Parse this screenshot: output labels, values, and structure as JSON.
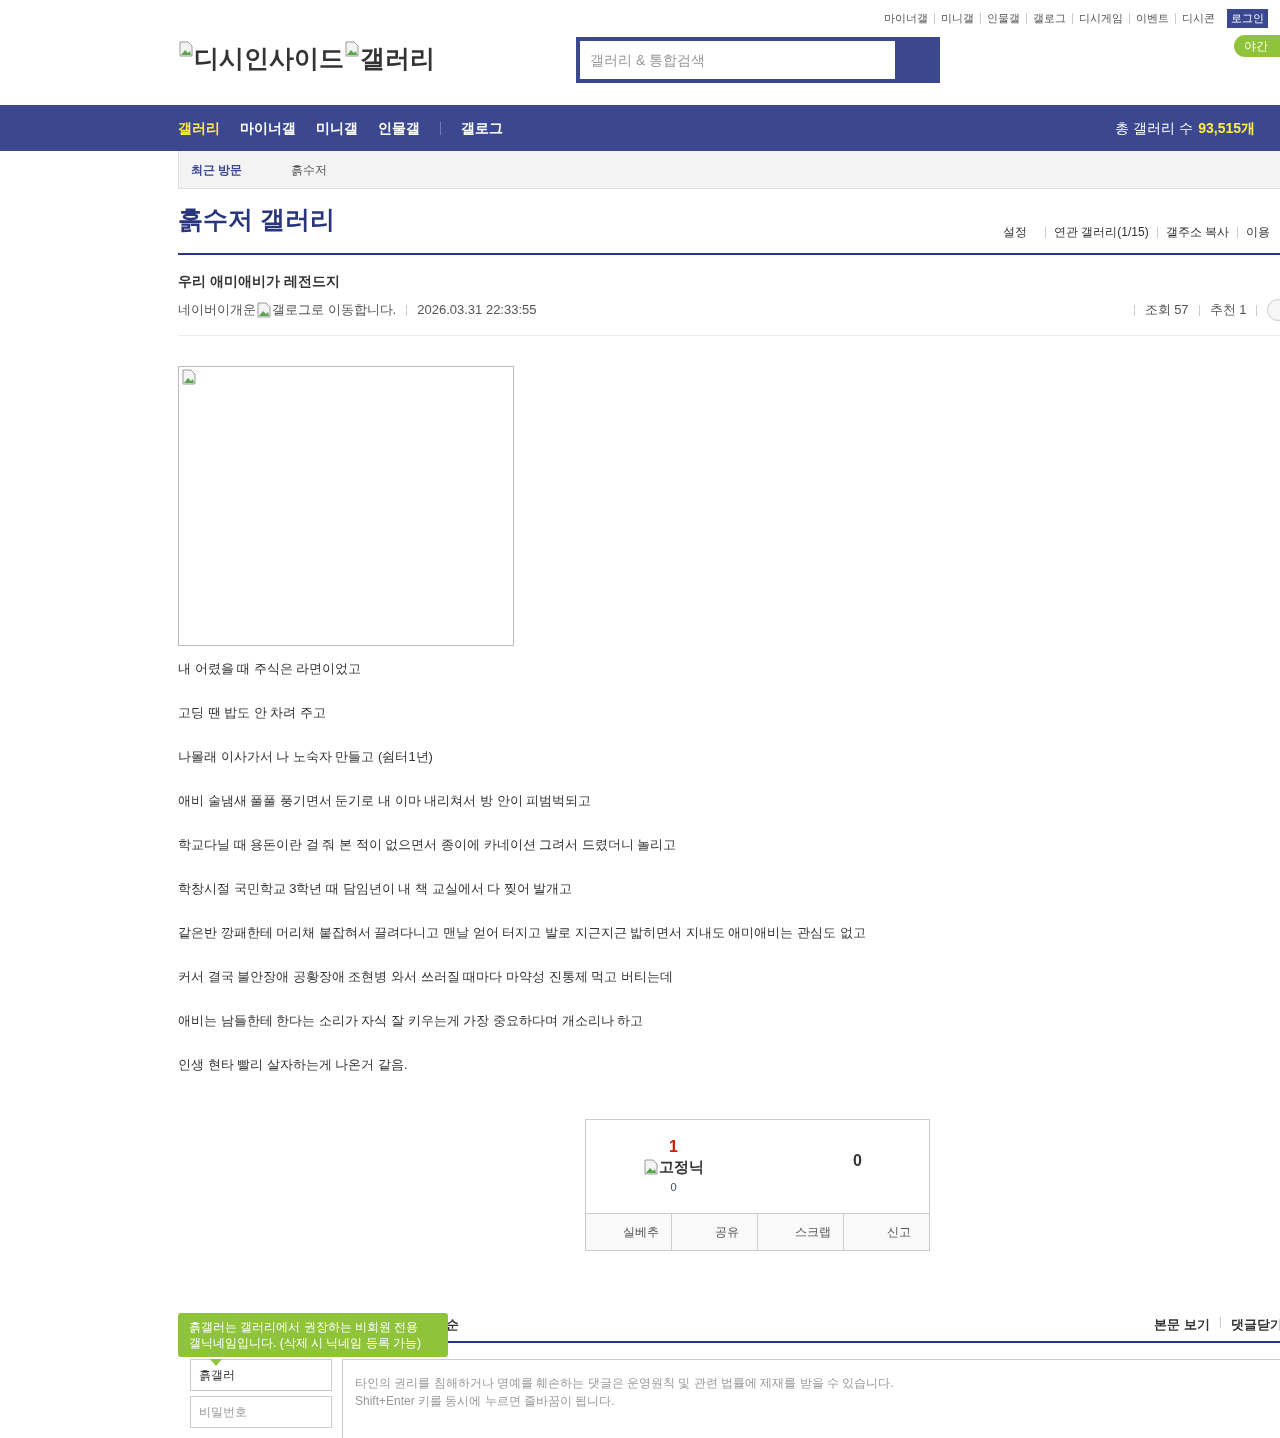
{
  "top_links": [
    "마이너갤",
    "미니갤",
    "인물갤",
    "갤로그",
    "디시게임",
    "이벤트",
    "디시콘"
  ],
  "login_button": "로그인",
  "night_mode_button": "야간",
  "logo": {
    "site": "디시인사이드",
    "section": "갤러리"
  },
  "search": {
    "placeholder": "갤러리 & 통합검색"
  },
  "nav": [
    {
      "label": "갤러리",
      "selected": true
    },
    {
      "label": "마이너갤",
      "selected": false
    },
    {
      "label": "미니갤",
      "selected": false
    },
    {
      "label": "인물갤",
      "selected": false
    },
    {
      "label": "갤로그",
      "selected": false
    }
  ],
  "gallery_count": {
    "label": "총 갤러리 수",
    "value": "93,515개"
  },
  "recent": {
    "label": "최근 방문",
    "items": [
      "흙수저"
    ]
  },
  "gallery_title": "흙수저 갤러리",
  "gallery_tools": [
    "설정",
    "연관 갤러리(1/15)",
    "갤주소 복사",
    "이용"
  ],
  "post": {
    "title": "우리 애미애비가 레전드지",
    "author": "네이버이개운",
    "author_note": "갤로그로 이동합니다.",
    "date": "2026.03.31 22:33:55",
    "views": "조회 57",
    "recommends": "추천 1",
    "paragraphs": [
      "내 어렸을 때 주식은 라면이었고",
      "고딩 땐 밥도 안 차려 주고",
      "나몰래 이사가서 나 노숙자 만들고 (쉼터1년)",
      "애비 술냄새 풀풀 풍기면서 둔기로 내 이마 내리쳐서 방 안이 피범벅되고",
      "학교다닐 때 용돈이란 걸 줘 본 적이 없으면서 종이에 카네이션 그려서 드렸더니 놀리고",
      "학창시절 국민학교 3학년 때 담임년이 내 책 교실에서 다 찢어 발개고",
      "같은반 깡패한테 머리채 붙잡혀서 끌려다니고 맨날 얻어 터지고 발로 지근지근 밟히면서 지내도 애미애비는 관심도 없고",
      "커서 결국 불안장애 공황장애 조현병 와서 쓰러질 때마다 마약성 진통제 먹고 버티는데",
      "애비는 남들한테 한다는 소리가 자식 잘 키우는게 가장 중요하다며 개소리나 하고",
      "인생 현타 빨리 살자하는게 나온거 같음."
    ]
  },
  "vote": {
    "up_count": "1",
    "fixed_nick_label": "고정닉",
    "fixed_nick_count": "0",
    "down_count": "0",
    "actions": [
      "실베추",
      "공유",
      "스크랩",
      "신고"
    ]
  },
  "comments": {
    "heading_fragment": "순",
    "tooltip": "흙갤러는 갤러리에서 권장하는 비회원 전용\n갤닉네임입니다. (삭제 시 닉네임 등록 가능)",
    "links": [
      "본문 보기",
      "댓글닫기"
    ],
    "nickname": "흙갤러",
    "password_placeholder": "비밀번호",
    "comment_placeholder": "타인의 권리를 침해하거나 명예를 훼손하는 댓글은 운영원칙 및 관련 법률에 제재를 받을 수 있습니다.\nShift+Enter 키를 동시에 누르면 줄바꿈이 됩니다."
  }
}
